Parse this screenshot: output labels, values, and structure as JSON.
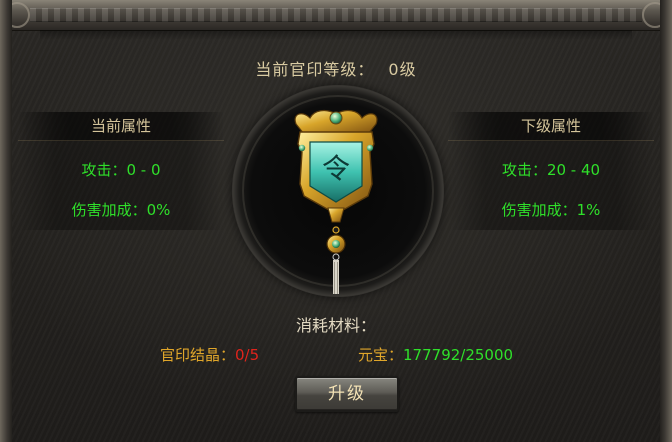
{
  "panel": {
    "title_label": "当前官印等级：",
    "title_value": "0级"
  },
  "current_attrs": {
    "header": "当前属性",
    "attack": "攻击：0 - 0",
    "damage_bonus": "伤害加成：0%"
  },
  "next_attrs": {
    "header": "下级属性",
    "attack": "攻击：20 - 40",
    "damage_bonus": "伤害加成：1%"
  },
  "medal": {
    "glyph": "令",
    "icon": "official-seal-medal-icon"
  },
  "cost": {
    "title": "消耗材料：",
    "crystal_label": "官印结晶：",
    "crystal_value": "0/5",
    "ingot_label": "元宝：",
    "ingot_value": "177792/25000"
  },
  "actions": {
    "upgrade_label": "升级"
  },
  "colors": {
    "gold_text": "#d9cba2",
    "green_value": "#2fe02a",
    "red_value": "#e0241c",
    "orange_label": "#e0a62a",
    "medal_gold": "#d8a52a",
    "medal_jade": "#3fc2b0"
  }
}
